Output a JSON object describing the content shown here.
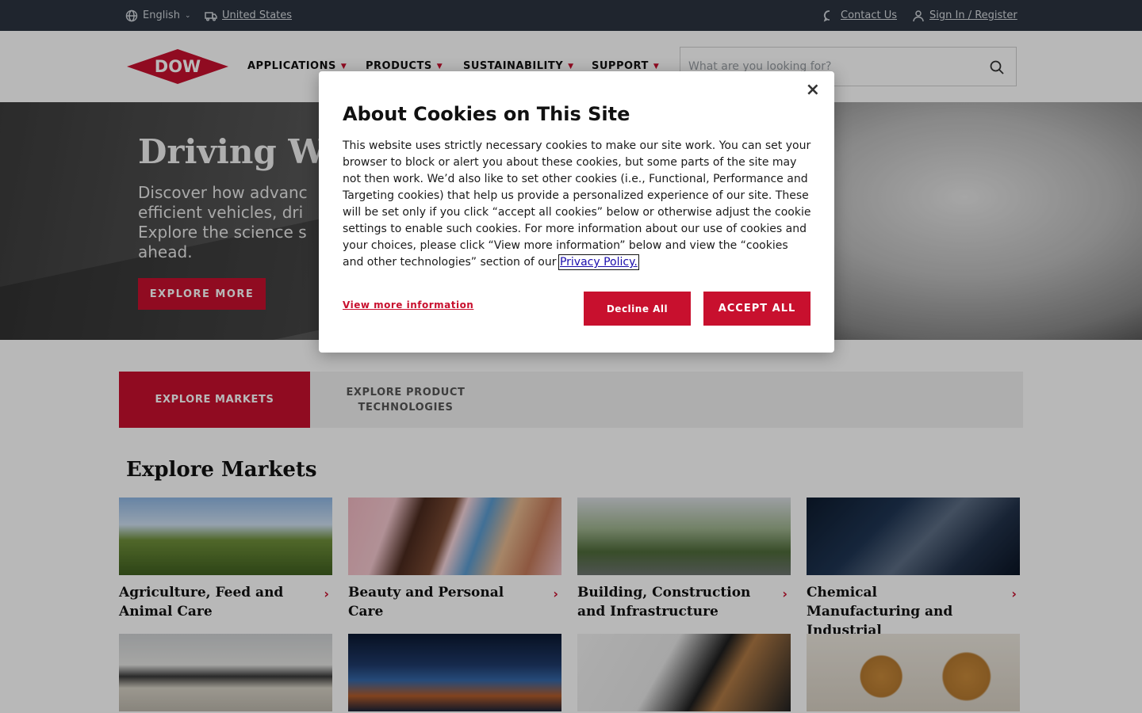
{
  "topbar": {
    "language": "English",
    "region": "United States",
    "contact": "Contact Us",
    "signin": "Sign In / Register"
  },
  "header": {
    "logo_text": "DOW",
    "nav": [
      "APPLICATIONS",
      "PRODUCTS",
      "SUSTAINABILITY",
      "SUPPORT"
    ],
    "search_placeholder": "What are you looking for?"
  },
  "hero": {
    "title": "Driving W",
    "description": "Discover how advanc efficient vehicles, dri Explore the science s ahead.",
    "desc_lines": [
      "Discover how advanc",
      "efficient vehicles, dri",
      "Explore the science s",
      "ahead."
    ],
    "cta": "EXPLORE MORE"
  },
  "tabs": {
    "markets": "EXPLORE MARKETS",
    "products_line1": "EXPLORE PRODUCT",
    "products_line2": "TECHNOLOGIES"
  },
  "markets": {
    "title": "Explore Markets",
    "cards": [
      {
        "label": "Agriculture, Feed and Animal Care"
      },
      {
        "label": "Beauty and Personal Care"
      },
      {
        "label": "Building, Construction and Infrastructure"
      },
      {
        "label": "Chemical Manufacturing and Industrial"
      }
    ]
  },
  "cookie_modal": {
    "close": "×",
    "title": "About Cookies on This Site",
    "body": "This website uses strictly necessary cookies to make our site work. You can set your browser to block or alert you about these cookies, but some parts of the site may not then work. We’d also like to set other cookies (i.e., Functional, Performance and Targeting cookies) that help us provide a personalized experience of our site. These will be set only if you click “accept all cookies” below or otherwise adjust the cookie settings to enable such cookies. For more information about our use of cookies and your choices, please click “View more information” below and view the “cookies and other technologies” section of our",
    "privacy_link": "Privacy Policy.",
    "view_more": "View more information",
    "decline": "Decline All",
    "accept": "ACCEPT ALL"
  },
  "colors": {
    "brand_red": "#c8102e",
    "topbar_bg": "#2b3440"
  },
  "icons": [
    "globe-icon",
    "truck-icon",
    "chat-icon",
    "user-icon",
    "search-icon",
    "chevron-right-icon",
    "close-icon"
  ]
}
